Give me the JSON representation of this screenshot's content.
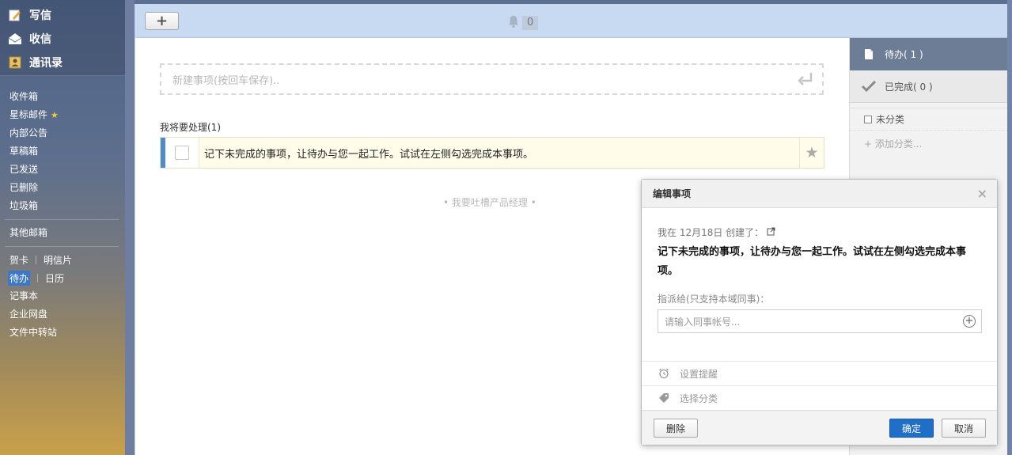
{
  "sidebar": {
    "top": [
      {
        "label": "写信",
        "icon": "compose-icon"
      },
      {
        "label": "收信",
        "icon": "inbox-icon"
      },
      {
        "label": "通讯录",
        "icon": "contacts-icon"
      }
    ],
    "folders": [
      "收件箱",
      "星标邮件",
      "内部公告",
      "草稿箱",
      "已发送",
      "已删除",
      "垃圾箱"
    ],
    "other_mailbox": "其他邮箱",
    "tools": {
      "greeting_card": "贺卡",
      "postcard": "明信片",
      "todo": "待办",
      "calendar": "日历",
      "notebook": "记事本",
      "netdisk": "企业网盘",
      "transfer": "文件中转站"
    }
  },
  "toolbar": {
    "add_label": "+",
    "notify_count": "0"
  },
  "content": {
    "new_item_placeholder": "新建事项(按回车保存)..",
    "section_title": "我将要处理(1)",
    "todo_text": "记下未完成的事项，让待办与您一起工作。试试在左侧勾选完成本事项。",
    "slogan": "• 我要吐槽产品经理 •"
  },
  "right_panel": {
    "tab_pending": "待办( 1 )",
    "tab_done": "已完成( 0 )",
    "uncategorized": "未分类",
    "add_category": "+ 添加分类..."
  },
  "dialog": {
    "title": "编辑事项",
    "close": "×",
    "meta": "我在 12月18日 创建了：",
    "item_text": "记下未完成的事项，让待办与您一起工作。试试在左侧勾选完成本事项。",
    "assign_label": "指派给(只支持本域同事)：",
    "assign_placeholder": "请输入同事帐号...",
    "reminder": "设置提醒",
    "category": "选择分类",
    "delete": "删除",
    "confirm": "确定",
    "cancel": "取消"
  },
  "colors": {
    "accent": "#1f6ec8",
    "active_tab": "#6e7d96",
    "todo_marker": "#4c8ec9"
  }
}
